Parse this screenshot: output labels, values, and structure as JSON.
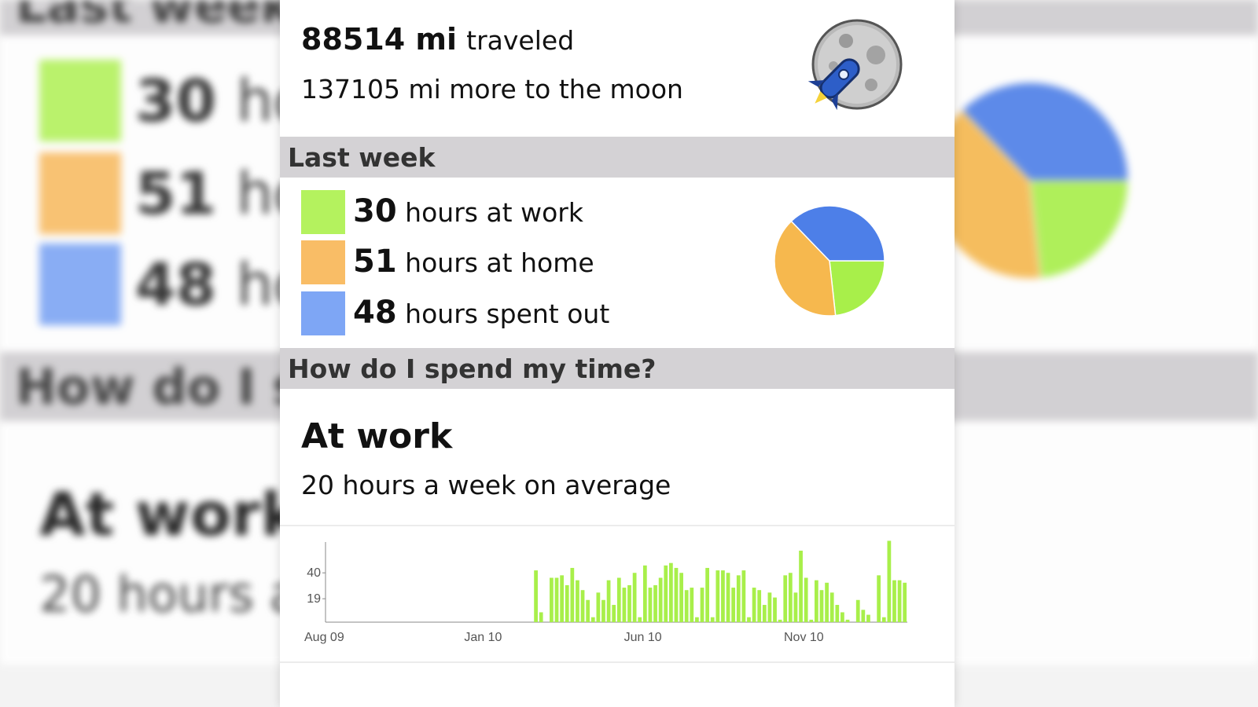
{
  "distance": {
    "value": "88514 mi",
    "label": "traveled",
    "remaining": "137105 mi more to the moon",
    "icon": "moon-rocket-icon"
  },
  "last_week": {
    "header": "Last week",
    "items": [
      {
        "num": "30",
        "text": "hours at work",
        "hours": 30,
        "color": "#b4f25e"
      },
      {
        "num": "51",
        "text": "hours at home",
        "hours": 51,
        "color": "#f9bd66"
      },
      {
        "num": "48",
        "text": "hours spent out",
        "hours": 48,
        "color": "#7ea6f5"
      }
    ],
    "pie_colors": {
      "work": "#a8ef4a",
      "home": "#f6b84e",
      "out": "#4d7fe8"
    }
  },
  "time_section": {
    "header": "How do I spend my time?",
    "title": "At work",
    "subtitle": "20 hours a week on average"
  },
  "chart_data": {
    "type": "bar",
    "x_labels": [
      "Aug 09",
      "Jan 10",
      "Jun 10",
      "Nov 10"
    ],
    "y_ticks": [
      19,
      40
    ],
    "ylim": [
      0,
      65
    ],
    "color": "#a8ef4a",
    "values": [
      0,
      0,
      0,
      0,
      0,
      0,
      0,
      0,
      0,
      0,
      0,
      0,
      0,
      0,
      0,
      0,
      0,
      0,
      0,
      0,
      0,
      0,
      0,
      0,
      0,
      0,
      0,
      0,
      0,
      0,
      0,
      0,
      0,
      0,
      0,
      0,
      0,
      0,
      0,
      0,
      42,
      8,
      0,
      36,
      36,
      38,
      30,
      44,
      34,
      26,
      18,
      4,
      24,
      18,
      34,
      14,
      36,
      28,
      30,
      40,
      4,
      46,
      28,
      30,
      36,
      46,
      48,
      44,
      40,
      26,
      28,
      4,
      28,
      44,
      4,
      42,
      42,
      40,
      28,
      38,
      42,
      4,
      28,
      26,
      14,
      24,
      20,
      2,
      38,
      40,
      24,
      58,
      36,
      2,
      34,
      26,
      32,
      24,
      14,
      8,
      2,
      0,
      18,
      10,
      6,
      0,
      38,
      4,
      66,
      34,
      34,
      32
    ],
    "xlabel": "",
    "ylabel": ""
  },
  "background": {
    "blur_lines": [
      "30",
      "51",
      "48"
    ],
    "blur_suffix": "ho",
    "blur_header": "How do I s",
    "blur_title": "At work",
    "blur_sub": "20 hours a",
    "blur_top": "Last week"
  }
}
